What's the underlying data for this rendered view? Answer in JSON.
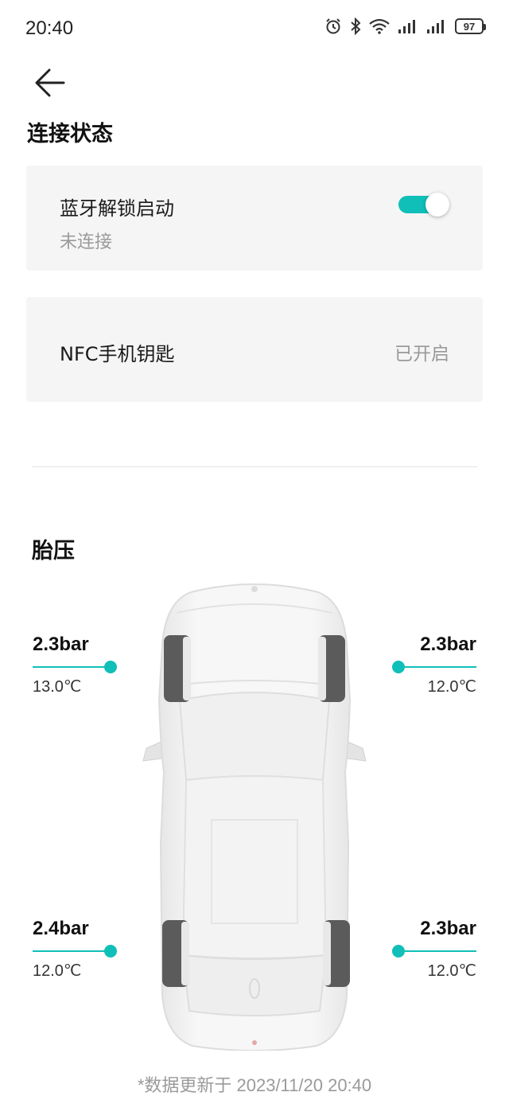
{
  "status_bar": {
    "time": "20:40",
    "battery": "97",
    "icons": [
      "alarm-icon",
      "bluetooth-icon",
      "wifi-icon",
      "signal-icon",
      "signal-icon"
    ]
  },
  "sections": {
    "connection_title": "连接状态",
    "tire_title": "胎压"
  },
  "bluetooth_card": {
    "title": "蓝牙解锁启动",
    "subtitle": "未连接",
    "toggle_on": true
  },
  "nfc_card": {
    "title": "NFC手机钥匙",
    "status": "已开启"
  },
  "tires": {
    "front_left": {
      "pressure": "2.3bar",
      "temp": "13.0℃"
    },
    "front_right": {
      "pressure": "2.3bar",
      "temp": "12.0℃"
    },
    "rear_left": {
      "pressure": "2.4bar",
      "temp": "12.0℃"
    },
    "rear_right": {
      "pressure": "2.3bar",
      "temp": "12.0℃"
    }
  },
  "footer": {
    "updated": "*数据更新于 2023/11/20 20:40"
  },
  "colors": {
    "accent": "#10bfb8",
    "card_bg": "#f5f5f5",
    "secondary_text": "#9a9a9a"
  }
}
